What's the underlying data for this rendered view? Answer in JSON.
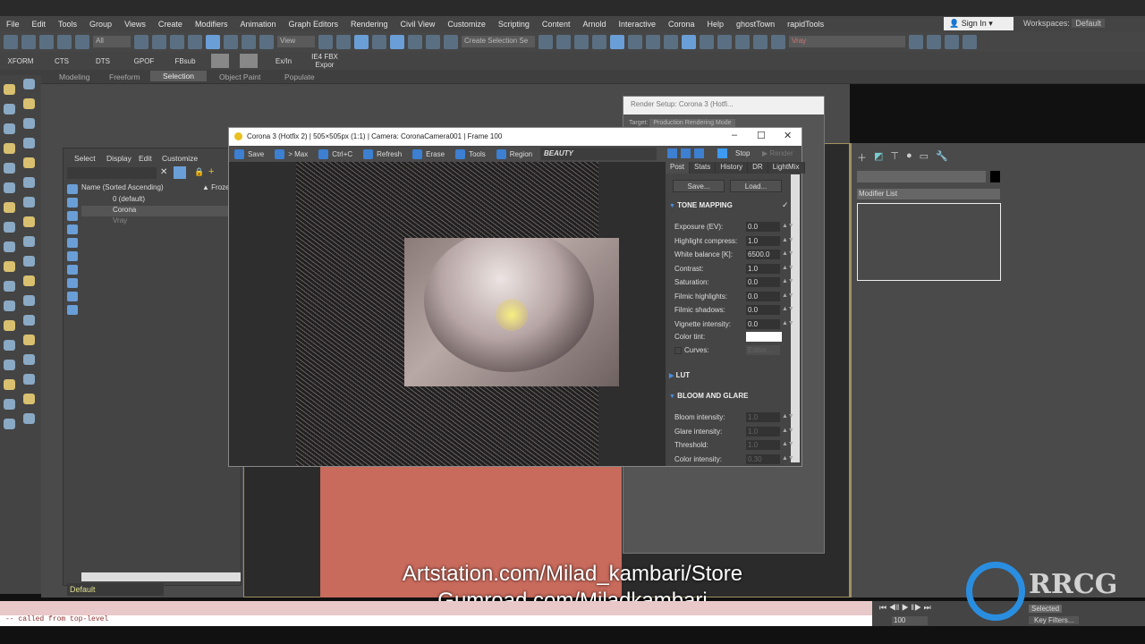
{
  "menu": [
    "File",
    "Edit",
    "Tools",
    "Group",
    "Views",
    "Create",
    "Modifiers",
    "Animation",
    "Graph Editors",
    "Rendering",
    "Civil View",
    "Customize",
    "Scripting",
    "Content",
    "Arnold",
    "Interactive",
    "Corona",
    "Help",
    "ghostTown",
    "rapidTools"
  ],
  "signin": "Sign In",
  "workspaces": {
    "label": "Workspaces:",
    "value": "Default"
  },
  "toolbar": {
    "filter": "All",
    "refcoord": "View",
    "selset": "Create Selection Se",
    "layer": "Vray"
  },
  "shelf": [
    "XFORM",
    "CTS",
    "DTS",
    "GPOF",
    "FBsub",
    "",
    "",
    "Ex/In",
    "IE4 FBX Expor"
  ],
  "ribbon": [
    "Modeling",
    "Freeform",
    "Selection",
    "Object Paint",
    "Populate"
  ],
  "explorer": {
    "menu": [
      "Select",
      "Display",
      "Edit",
      "Customize"
    ],
    "col_name": "Name (Sorted Ascending)",
    "col_frozen": "▲ Frozen",
    "rows": [
      "0 (default)",
      "Corona",
      "Vray"
    ],
    "layer": "Default"
  },
  "render_setup": {
    "title": "Render Setup: Corona 3 (Hotfi...",
    "target_label": "Target:",
    "target": "Production Rendering Mode"
  },
  "frame_buffer": {
    "title": "Corona 3 (Hotfix 2) | 505×505px (1:1) | Camera: CoronaCamera001 | Frame 100",
    "buttons": [
      "Save",
      "> Max",
      "Ctrl+C",
      "Refresh",
      "Erase",
      "Tools",
      "Region"
    ],
    "channel": "BEAUTY",
    "stop": "Stop",
    "render": "Render",
    "tabs": [
      "Post",
      "Stats",
      "History",
      "DR",
      "LightMix"
    ],
    "save": "Save...",
    "load": "Load...",
    "tone_mapping": "TONE MAPPING",
    "params": [
      {
        "label": "Exposure (EV):",
        "value": "0.0"
      },
      {
        "label": "Highlight compress:",
        "value": "1.0"
      },
      {
        "label": "White balance [K]:",
        "value": "6500.0"
      },
      {
        "label": "Contrast:",
        "value": "1.0"
      },
      {
        "label": "Saturation:",
        "value": "0.0"
      },
      {
        "label": "Filmic highlights:",
        "value": "0.0"
      },
      {
        "label": "Filmic shadows:",
        "value": "0.0"
      },
      {
        "label": "Vignette intensity:",
        "value": "0.0"
      }
    ],
    "color_tint": "Color tint:",
    "curves": "Curves:",
    "editor": "Editor...",
    "lut": "LUT",
    "bloom": "BLOOM AND GLARE",
    "bloom_params": [
      {
        "label": "Bloom intensity:",
        "value": "1.0"
      },
      {
        "label": "Glare intensity:",
        "value": "1.0"
      },
      {
        "label": "Threshold:",
        "value": "1.0"
      },
      {
        "label": "Color intensity:",
        "value": "0.30"
      }
    ]
  },
  "command_panel": {
    "modifier_list": "Modifier List"
  },
  "overlay": {
    "line1": "Artstation.com/Milad_kambari/Store",
    "line2": "Gumroad.com/Miladkambari"
  },
  "status": {
    "script": "-- called from top-level",
    "frame": "100",
    "key_filters": "Key Filters...",
    "selected": "Selected"
  },
  "watermark": "RRCG"
}
